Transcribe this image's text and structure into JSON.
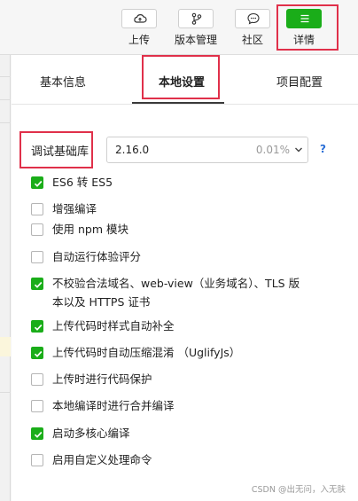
{
  "toolbar": {
    "items": [
      {
        "label": "上传",
        "icon": "cloud-upload-icon"
      },
      {
        "label": "版本管理",
        "icon": "branch-icon"
      },
      {
        "label": "社区",
        "icon": "chat-bubble-icon"
      },
      {
        "label": "详情",
        "icon": "menu-icon",
        "active": true
      }
    ]
  },
  "tabs": [
    {
      "label": "基本信息"
    },
    {
      "label": "本地设置",
      "active": true
    },
    {
      "label": "项目配置"
    }
  ],
  "library": {
    "label": "调试基础库",
    "version": "2.16.0",
    "usage": "0.01%",
    "help": "?"
  },
  "options": [
    {
      "label": "ES6 转 ES5",
      "checked": true
    },
    {
      "label": "增强编译",
      "checked": false
    },
    {
      "label": "使用 npm 模块",
      "checked": false
    },
    {
      "label": "自动运行体验评分",
      "checked": false
    },
    {
      "label": "不校验合法域名、web-view（业务域名）、TLS 版",
      "label2": "本以及 HTTPS 证书",
      "checked": true
    },
    {
      "label": "上传代码时样式自动补全",
      "checked": true
    },
    {
      "label": "上传代码时自动压缩混淆 （UglifyJs）",
      "checked": true
    },
    {
      "label": "上传时进行代码保护",
      "checked": false
    },
    {
      "label": "本地编译时进行合并编译",
      "checked": false
    },
    {
      "label": "启动多核心编译",
      "checked": true
    },
    {
      "label": "启用自定义处理命令",
      "checked": false
    }
  ],
  "watermark": "CSDN @出无问，入无肤",
  "colors": {
    "accent_green": "#1aad19",
    "highlight_red": "#e0304a",
    "help_blue": "#2b6fd6"
  }
}
